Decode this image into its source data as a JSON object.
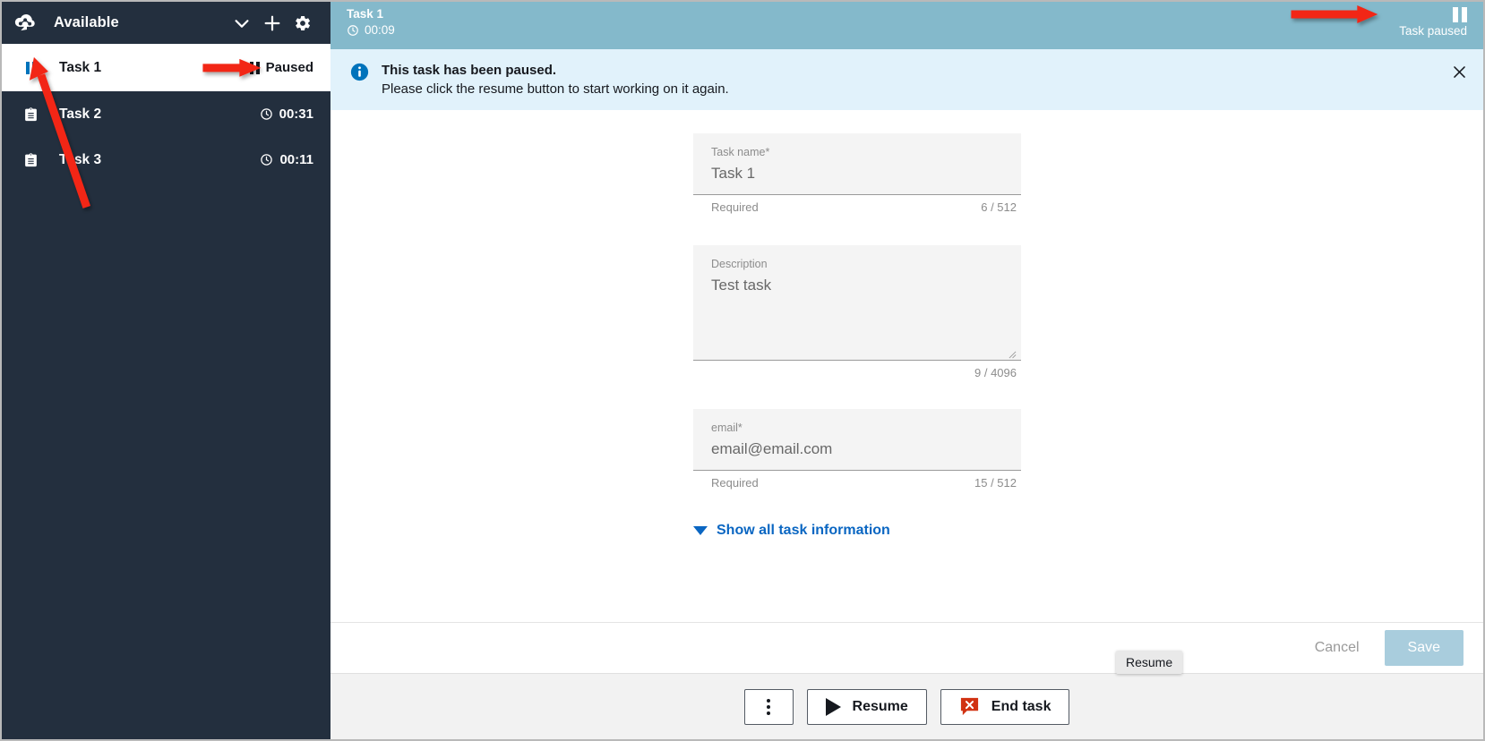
{
  "sidebar": {
    "logo_icon": "cloud-graph-logo",
    "status_label": "Available",
    "chevron_icon": "chevron-down-icon",
    "add_icon": "plus-icon",
    "settings_icon": "gear-icon",
    "tasks": [
      {
        "name": "Task 1",
        "icon": "pause-icon",
        "status_text": "Paused",
        "status_icon": "pause-icon",
        "active": true
      },
      {
        "name": "Task 2",
        "icon": "clipboard-icon",
        "status_text": "00:31",
        "status_icon": "clock-icon",
        "active": false
      },
      {
        "name": "Task 3",
        "icon": "clipboard-icon",
        "status_text": "00:11",
        "status_icon": "clock-icon",
        "active": false
      }
    ]
  },
  "task_banner": {
    "title": "Task 1",
    "elapsed": "00:09",
    "clock_icon": "clock-icon",
    "pause_icon": "pause-icon",
    "status": "Task paused",
    "bg_color": "#84b9cb"
  },
  "info_banner": {
    "icon": "info-circle-icon",
    "title": "This task has been paused.",
    "subtitle": "Please click the resume button to start working on it again.",
    "close_icon": "close-icon",
    "bg_color": "#e1f2fb"
  },
  "form": {
    "task_name": {
      "label": "Task name*",
      "value": "Task 1",
      "hint": "Required",
      "counter": "6 / 512"
    },
    "description": {
      "label": "Description",
      "value": "Test task",
      "counter": "9 / 4096"
    },
    "email": {
      "label": "email*",
      "value": "email@email.com",
      "hint": "Required",
      "counter": "15 / 512"
    },
    "show_all_label": "Show all task information",
    "show_all_caret": "caret-down-icon",
    "link_color": "#0a66c2"
  },
  "save_bar": {
    "cancel_label": "Cancel",
    "save_label": "Save",
    "save_color": "#a9cddd"
  },
  "action_bar": {
    "tooltip": "Resume",
    "more_icon": "kebab-menu-icon",
    "resume_icon": "play-icon",
    "resume_label": "Resume",
    "end_icon": "end-task-icon",
    "end_label": "End task",
    "end_icon_color": "#d13212"
  }
}
